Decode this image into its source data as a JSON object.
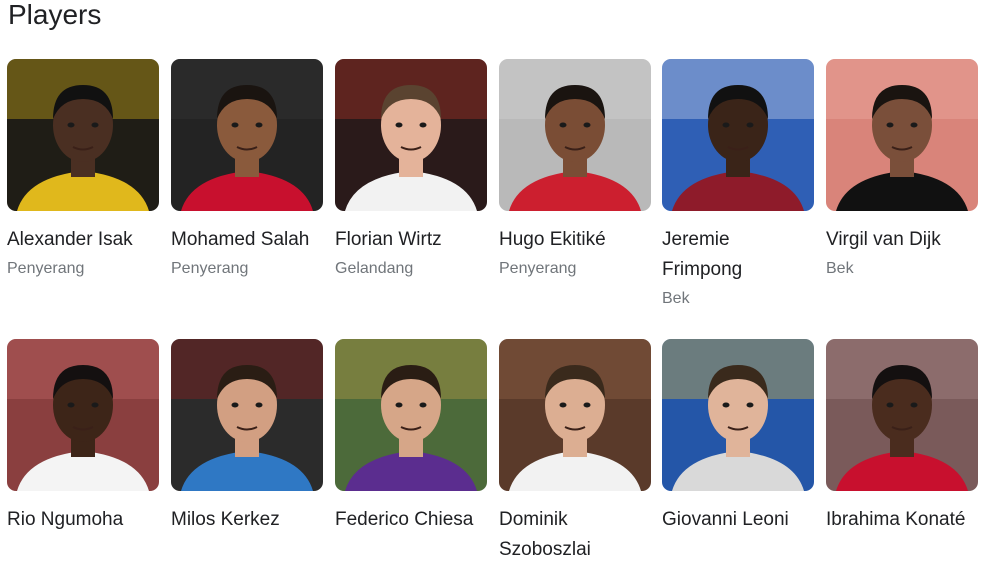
{
  "section_title": "Players",
  "players": [
    {
      "name": "Alexander Isak",
      "position": "Penyerang",
      "bg": "#1f1d16",
      "accent": "#e8c21a",
      "skin": "#4a2f22",
      "hair": "#111111",
      "shirt": "#e0b81c"
    },
    {
      "name": "Mohamed Salah",
      "position": "Penyerang",
      "bg": "#232323",
      "accent": "#3a3a3a",
      "skin": "#8a5a3c",
      "hair": "#1a1410",
      "shirt": "#c8102e"
    },
    {
      "name": "Florian Wirtz",
      "position": "Gelandang",
      "bg": "#2a1a1a",
      "accent": "#c0392b",
      "skin": "#e4b39a",
      "hair": "#5a4330",
      "shirt": "#f2f2f2"
    },
    {
      "name": "Hugo Ekitiké",
      "position": "Penyerang",
      "bg": "#b9b9b9",
      "accent": "#d8d8d8",
      "skin": "#7a4d35",
      "hair": "#1a1410",
      "shirt": "#cc1f2f"
    },
    {
      "name": "Jeremie Frimpong",
      "position": "Bek",
      "bg": "#2f5fb5",
      "accent": "#dfe6f2",
      "skin": "#3a2418",
      "hair": "#111111",
      "shirt": "#8e1b2a"
    },
    {
      "name": "Virgil van Dijk",
      "position": "Bek",
      "bg": "#d9847a",
      "accent": "#f0b1a8",
      "skin": "#7a4f3a",
      "hair": "#1a1410",
      "shirt": "#111111"
    },
    {
      "name": "Rio Ngumoha",
      "position": "",
      "bg": "#8a3f3f",
      "accent": "#c76a6a",
      "skin": "#3d2518",
      "hair": "#141010",
      "shirt": "#f4f4f4"
    },
    {
      "name": "Milos Kerkez",
      "position": "",
      "bg": "#2b2b2b",
      "accent": "#9c1d1d",
      "skin": "#d29f82",
      "hair": "#2a1d14",
      "shirt": "#2f78c4"
    },
    {
      "name": "Federico Chiesa",
      "position": "",
      "bg": "#4c6a3a",
      "accent": "#c9a24a",
      "skin": "#d6a688",
      "hair": "#2a1d14",
      "shirt": "#5b2d8f"
    },
    {
      "name": "Dominik Szoboszlai",
      "position": "",
      "bg": "#5a3a2a",
      "accent": "#9a6a4a",
      "skin": "#dcae92",
      "hair": "#3a2a1c",
      "shirt": "#f2f2f2"
    },
    {
      "name": "Giovanni Leoni",
      "position": "",
      "bg": "#2456a8",
      "accent": "#f2c230",
      "skin": "#e0b49a",
      "hair": "#3a2a1c",
      "shirt": "#d9d9d9"
    },
    {
      "name": "Ibrahima Konaté",
      "position": "",
      "bg": "#7a5a5a",
      "accent": "#b08f8f",
      "skin": "#4a2c1e",
      "hair": "#141010",
      "shirt": "#c8102e"
    }
  ]
}
